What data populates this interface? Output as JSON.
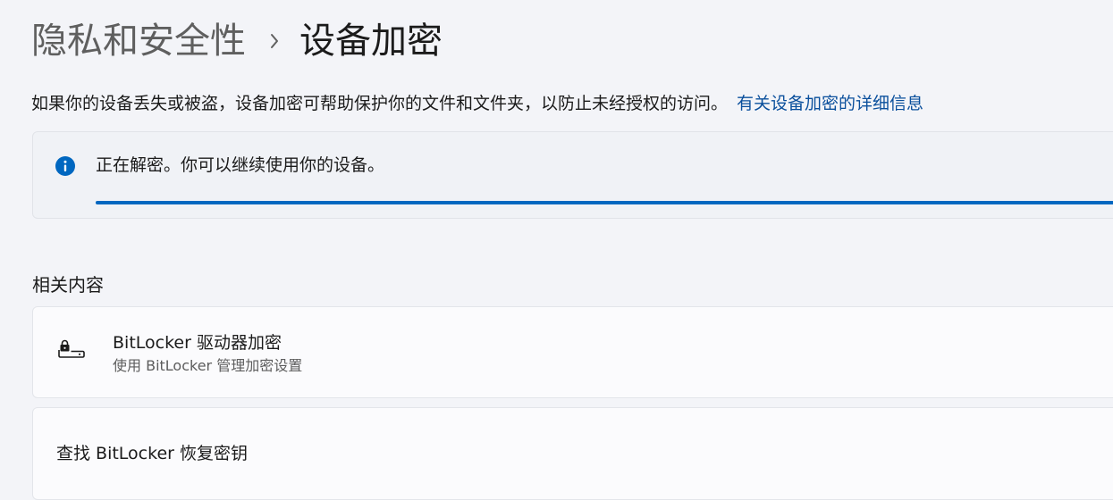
{
  "breadcrumb": {
    "parent": "隐私和安全性",
    "separator_icon": "chevron-right-icon",
    "current": "设备加密"
  },
  "description": {
    "text": "如果你的设备丢失或被盗，设备加密可帮助保护你的文件和文件夹，以防止未经授权的访问。",
    "link": "有关设备加密的详细信息"
  },
  "status": {
    "icon": "info-icon",
    "message": "正在解密。你可以继续使用你的设备。",
    "progress": 1.0
  },
  "related": {
    "title": "相关内容",
    "items": [
      {
        "icon": "lock-drive-icon",
        "title": "BitLocker 驱动器加密",
        "subtitle": "使用 BitLocker 管理加密设置"
      },
      {
        "title": "查找 BitLocker 恢复密钥"
      }
    ]
  },
  "colors": {
    "accent": "#0067c0",
    "link": "#0a4f9c",
    "background": "#f3f4f8"
  }
}
